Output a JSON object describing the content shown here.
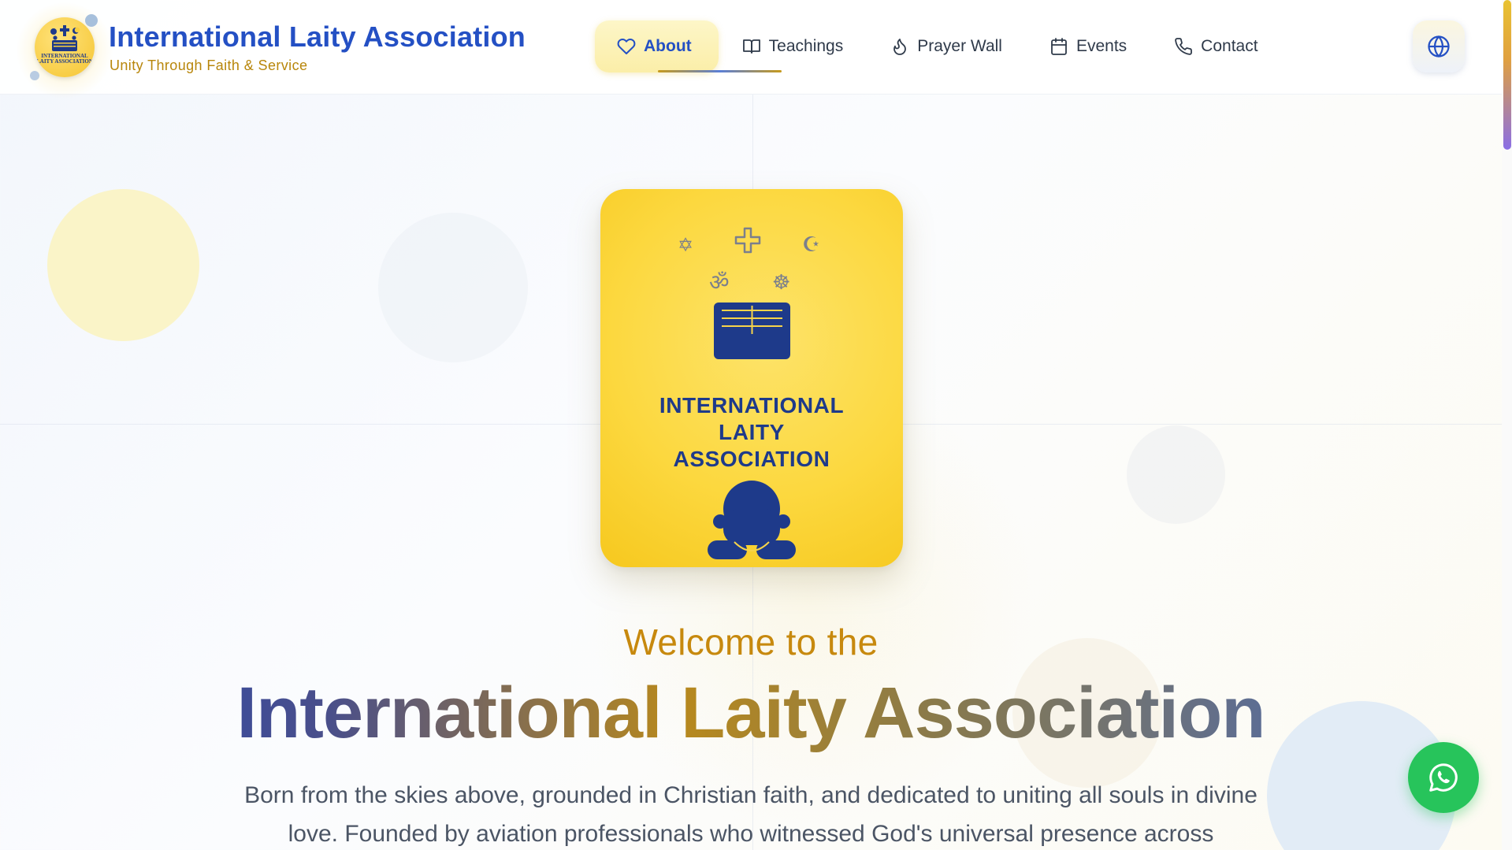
{
  "brand": {
    "title": "International Laity Association",
    "subtitle": "Unity Through Faith & Service",
    "logo_text": "INTERNATIONAL LAITY ASSOCIATION"
  },
  "nav": {
    "items": [
      {
        "label": "About",
        "icon": "heart-icon",
        "active": true
      },
      {
        "label": "Teachings",
        "icon": "book-icon",
        "active": false
      },
      {
        "label": "Prayer Wall",
        "icon": "flame-icon",
        "active": false
      },
      {
        "label": "Events",
        "icon": "calendar-icon",
        "active": false
      },
      {
        "label": "Contact",
        "icon": "phone-icon",
        "active": false
      }
    ],
    "language_icon": "globe-icon"
  },
  "hero": {
    "card_title_line1": "INTERNATIONAL",
    "card_title_line2": "LAITY",
    "card_title_line3": "ASSOCIATION",
    "card_symbols": [
      "star-of-david-icon",
      "cross-icon",
      "crescent-star-icon",
      "om-icon",
      "dharma-wheel-icon"
    ],
    "welcome": "Welcome to the",
    "title": "International Laity Association",
    "description": "Born from the skies above, grounded in Christian faith, and dedicated to uniting all souls in divine love. Founded by aviation professionals who witnessed God's universal presence across"
  },
  "colors": {
    "brand_blue": "#2450c4",
    "gold": "#c7890e",
    "card_yellow": "#fcd83f",
    "whatsapp_green": "#27c45b"
  },
  "floating": {
    "whatsapp_icon": "whatsapp-icon"
  }
}
